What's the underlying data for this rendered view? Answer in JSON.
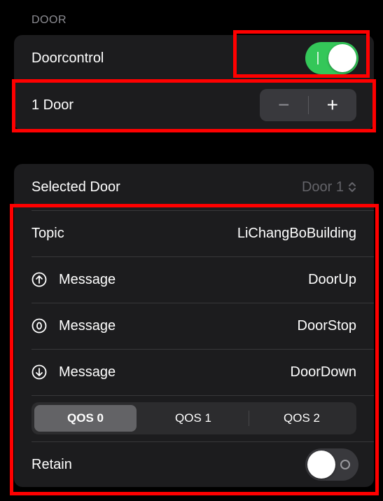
{
  "section": {
    "header": "DOOR"
  },
  "doorcontrol": {
    "label": "Doorcontrol",
    "toggle_on": true
  },
  "door_count": {
    "label": "1 Door",
    "minus": "−",
    "plus": "+"
  },
  "selected_door": {
    "label": "Selected Door",
    "value": "Door 1",
    "chevron": "⌃⌄"
  },
  "topic": {
    "label": "Topic",
    "value": "LiChangBoBuilding"
  },
  "messages": [
    {
      "icon": "arrow-up-circle-icon",
      "label": "Message",
      "value": "DoorUp"
    },
    {
      "icon": "zero-circle-icon",
      "label": "Message",
      "value": "DoorStop"
    },
    {
      "icon": "arrow-down-circle-icon",
      "label": "Message",
      "value": "DoorDown"
    }
  ],
  "qos": {
    "options": [
      "QOS 0",
      "QOS 1",
      "QOS 2"
    ],
    "selected": "QOS 0"
  },
  "retain": {
    "label": "Retain",
    "toggle_on": false
  },
  "colors": {
    "accent_on": "#34c759",
    "highlight": "#ff0000",
    "card": "#1c1c1e"
  }
}
